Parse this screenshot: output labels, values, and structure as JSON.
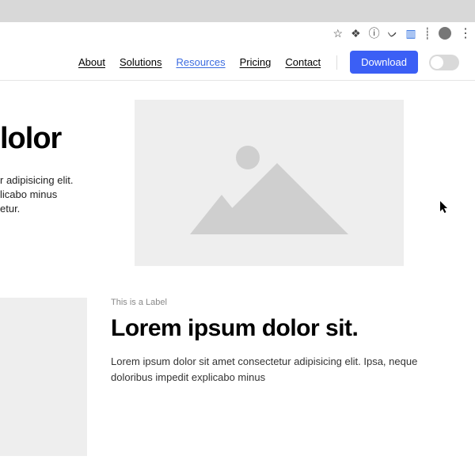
{
  "nav": {
    "items": [
      "About",
      "Solutions",
      "Resources",
      "Pricing",
      "Contact"
    ],
    "active_index": 2,
    "download_label": "Download"
  },
  "hero": {
    "title_fragment": "lolor",
    "body_line1": "r adipisicing elit.",
    "body_line2": "licabo minus",
    "body_line3": "etur."
  },
  "section2": {
    "label": "This is a Label",
    "heading": "Lorem ipsum dolor sit.",
    "body": "Lorem ipsum dolor sit amet consectetur adipisicing elit. Ipsa, neque doloribus impedit explicabo minus"
  }
}
